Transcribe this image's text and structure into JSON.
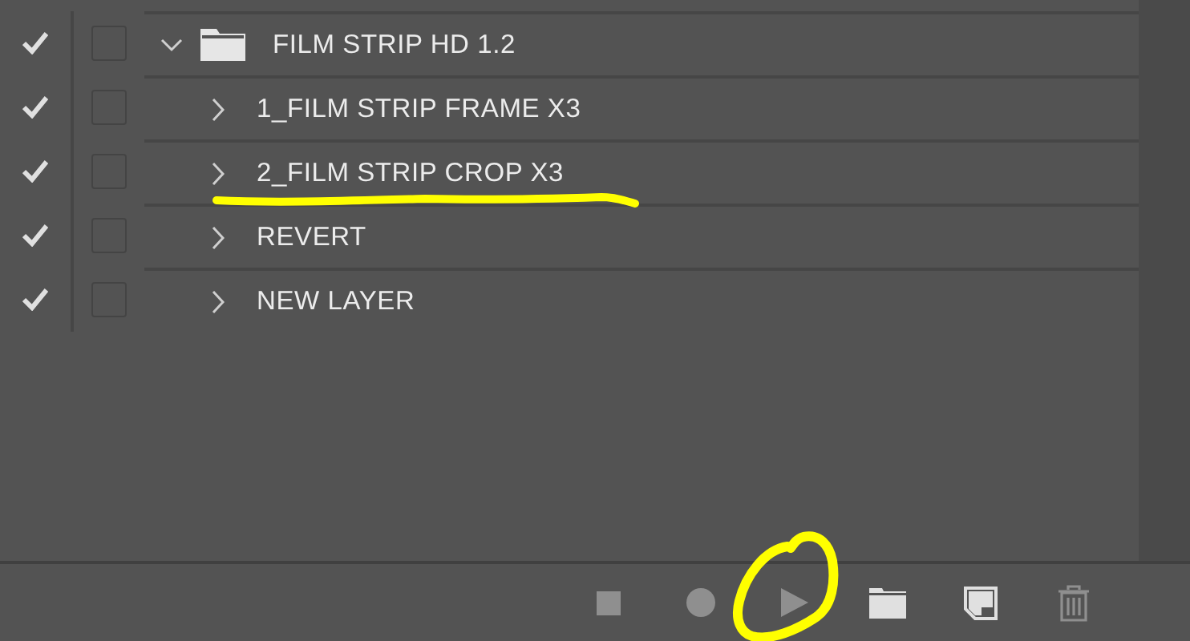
{
  "actions": [
    {
      "label": "FILM STRIP HD 1.2",
      "enabled": true,
      "dialog": false,
      "expanded": true,
      "children": [
        {
          "label": "1_FILM STRIP FRAME X3",
          "enabled": true,
          "dialog": false,
          "expanded": false
        },
        {
          "label": "2_FILM STRIP CROP X3",
          "enabled": true,
          "dialog": false,
          "expanded": false
        },
        {
          "label": "REVERT",
          "enabled": true,
          "dialog": false,
          "expanded": false
        },
        {
          "label": "NEW LAYER",
          "enabled": true,
          "dialog": false,
          "expanded": false
        }
      ]
    }
  ],
  "toolbar": [
    {
      "kind": "stop",
      "disabled": true
    },
    {
      "kind": "record",
      "disabled": true
    },
    {
      "kind": "play",
      "disabled": true
    },
    {
      "kind": "new-set",
      "disabled": false
    },
    {
      "kind": "new-action",
      "disabled": false
    },
    {
      "kind": "delete",
      "disabled": true
    }
  ]
}
